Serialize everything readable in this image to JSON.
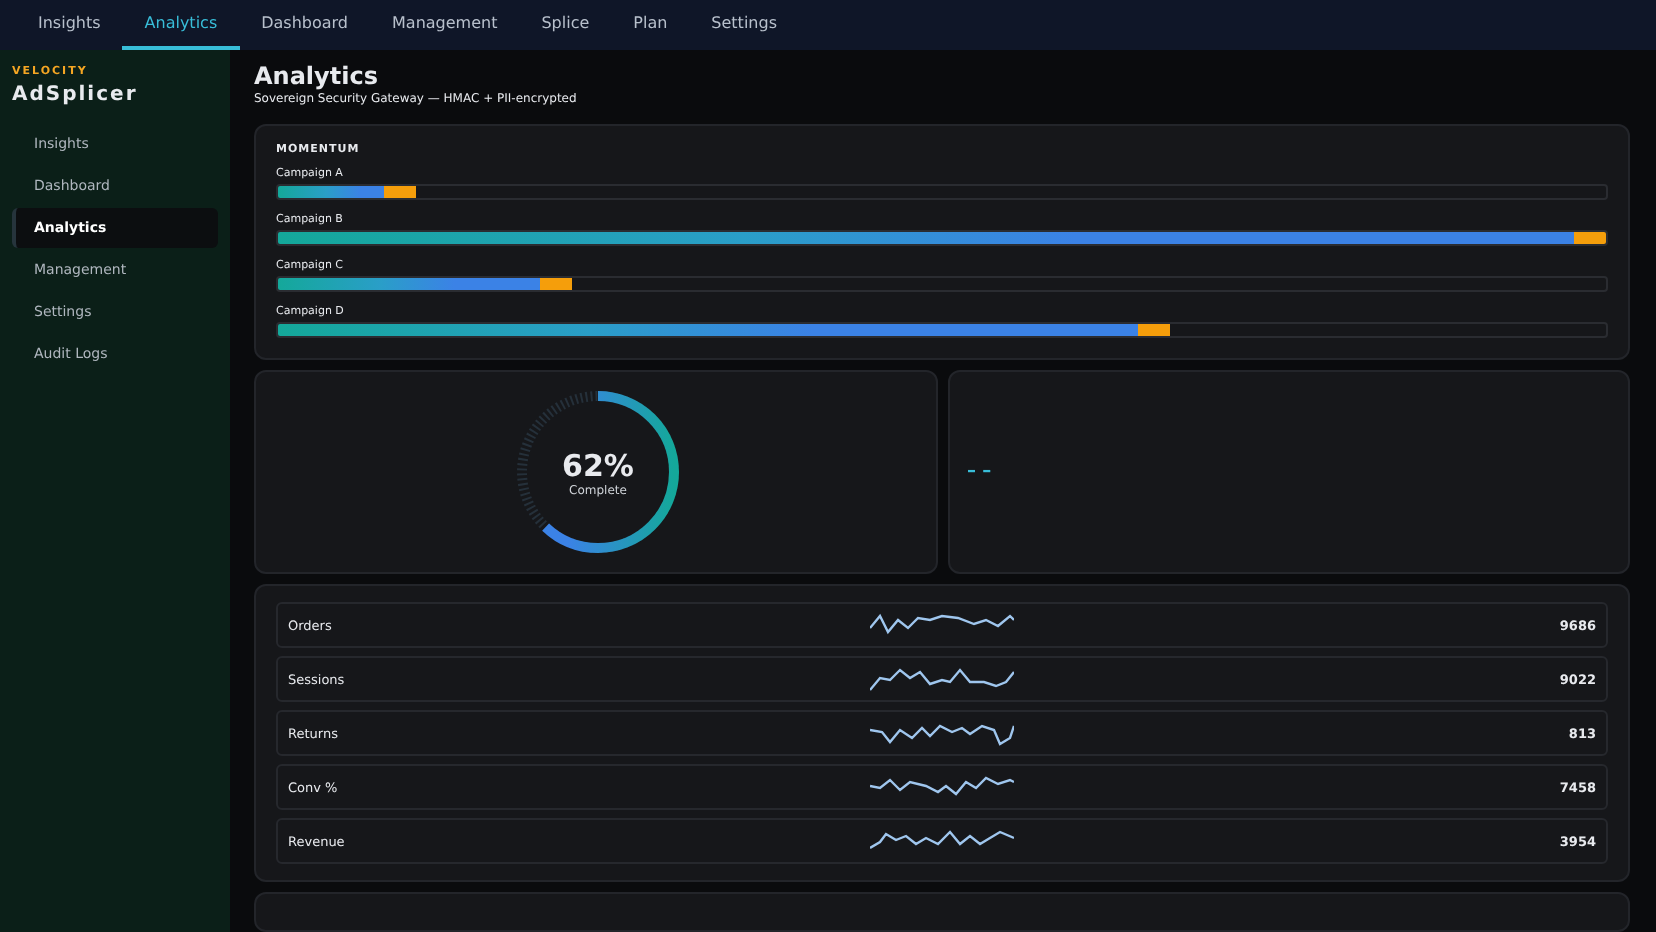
{
  "top_tabs": [
    {
      "label": "Insights",
      "selected": false
    },
    {
      "label": "Analytics",
      "selected": true
    },
    {
      "label": "Dashboard",
      "selected": false
    },
    {
      "label": "Management",
      "selected": false
    },
    {
      "label": "Splice",
      "selected": false
    },
    {
      "label": "Plan",
      "selected": false
    },
    {
      "label": "Settings",
      "selected": false
    }
  ],
  "sidebar": {
    "brand_kicker": "VELOCITY",
    "brand": "AdSplicer",
    "items": [
      {
        "label": "Insights",
        "selected": false
      },
      {
        "label": "Dashboard",
        "selected": false
      },
      {
        "label": "Analytics",
        "selected": true
      },
      {
        "label": "Management",
        "selected": false
      },
      {
        "label": "Settings",
        "selected": false
      },
      {
        "label": "Audit Logs",
        "selected": false
      }
    ]
  },
  "page": {
    "title": "Analytics",
    "subtitle": "Sovereign Security Gateway — HMAC + PII-encrypted"
  },
  "momentum": {
    "title": "MOMENTUM",
    "campaigns": [
      {
        "name": "Campaign A",
        "level": 0.104
      },
      {
        "name": "Campaign B",
        "level": 1.0
      },
      {
        "name": "Campaign C",
        "level": 0.222
      },
      {
        "name": "Campaign D",
        "level": 0.672
      }
    ]
  },
  "progress": {
    "level": 0.62,
    "value": "62%",
    "caption": "Complete"
  },
  "placeholder_panel": {
    "text": "– –"
  },
  "metrics": [
    {
      "label": "Orders",
      "value": "9686"
    },
    {
      "label": "Sessions",
      "value": "9022"
    },
    {
      "label": "Returns",
      "value": "813"
    },
    {
      "label": "Conv %",
      "value": "7458"
    },
    {
      "label": "Revenue",
      "value": "3954"
    }
  ]
}
